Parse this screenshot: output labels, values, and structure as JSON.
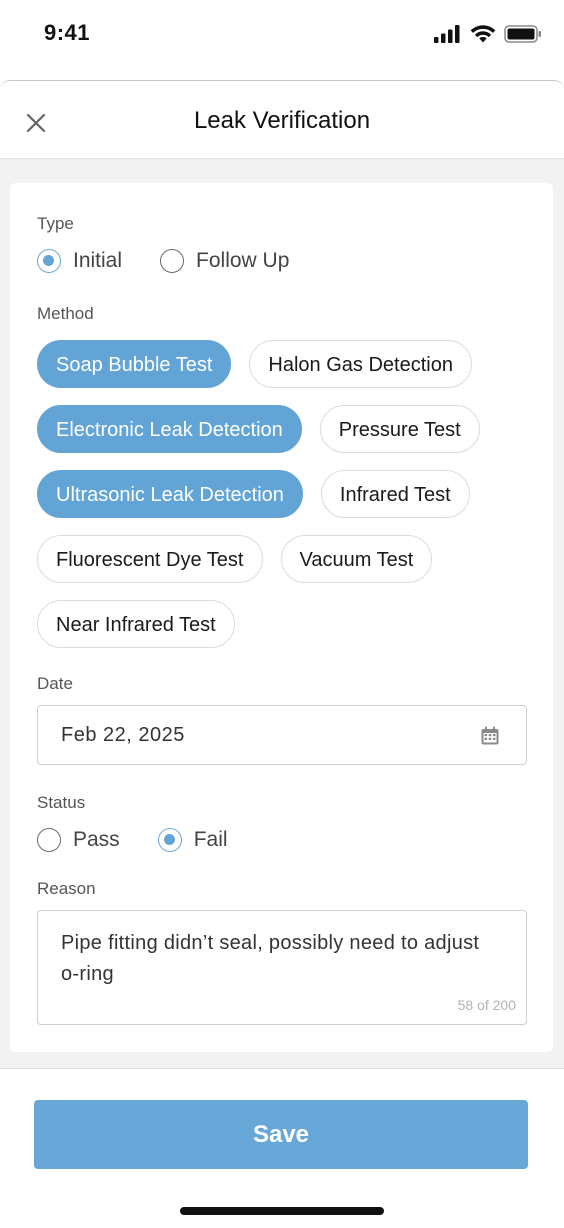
{
  "status_bar": {
    "time": "9:41",
    "icons": [
      "signal-icon",
      "wifi-icon",
      "battery-icon"
    ]
  },
  "header": {
    "title": "Leak Verification",
    "close_icon": "close-icon"
  },
  "form": {
    "type": {
      "label": "Type",
      "options": [
        {
          "label": "Initial",
          "checked": true
        },
        {
          "label": "Follow Up",
          "checked": false
        }
      ]
    },
    "method": {
      "label": "Method",
      "chips": [
        {
          "label": "Soap Bubble Test",
          "selected": true
        },
        {
          "label": "Halon Gas Detection",
          "selected": false
        },
        {
          "label": "Electronic Leak Detection",
          "selected": true
        },
        {
          "label": "Pressure Test",
          "selected": false
        },
        {
          "label": "Ultrasonic Leak Detection",
          "selected": true
        },
        {
          "label": "Infrared Test",
          "selected": false
        },
        {
          "label": "Fluorescent Dye Test",
          "selected": false
        },
        {
          "label": "Vacuum Test",
          "selected": false
        },
        {
          "label": "Near Infrared Test",
          "selected": false
        }
      ]
    },
    "date": {
      "label": "Date",
      "value": "Feb 22, 2025",
      "icon": "calendar-icon"
    },
    "status": {
      "label": "Status",
      "options": [
        {
          "label": "Pass",
          "checked": false
        },
        {
          "label": "Fail",
          "checked": true
        }
      ]
    },
    "reason": {
      "label": "Reason",
      "value": "Pipe fitting didn’t seal, possibly need to adjust o-ring",
      "char_count": "58 of 200"
    }
  },
  "footer": {
    "save_label": "Save"
  },
  "colors": {
    "accent": "#62a4d6",
    "save_button": "#67a8d8",
    "background": "#f2f2f2"
  }
}
